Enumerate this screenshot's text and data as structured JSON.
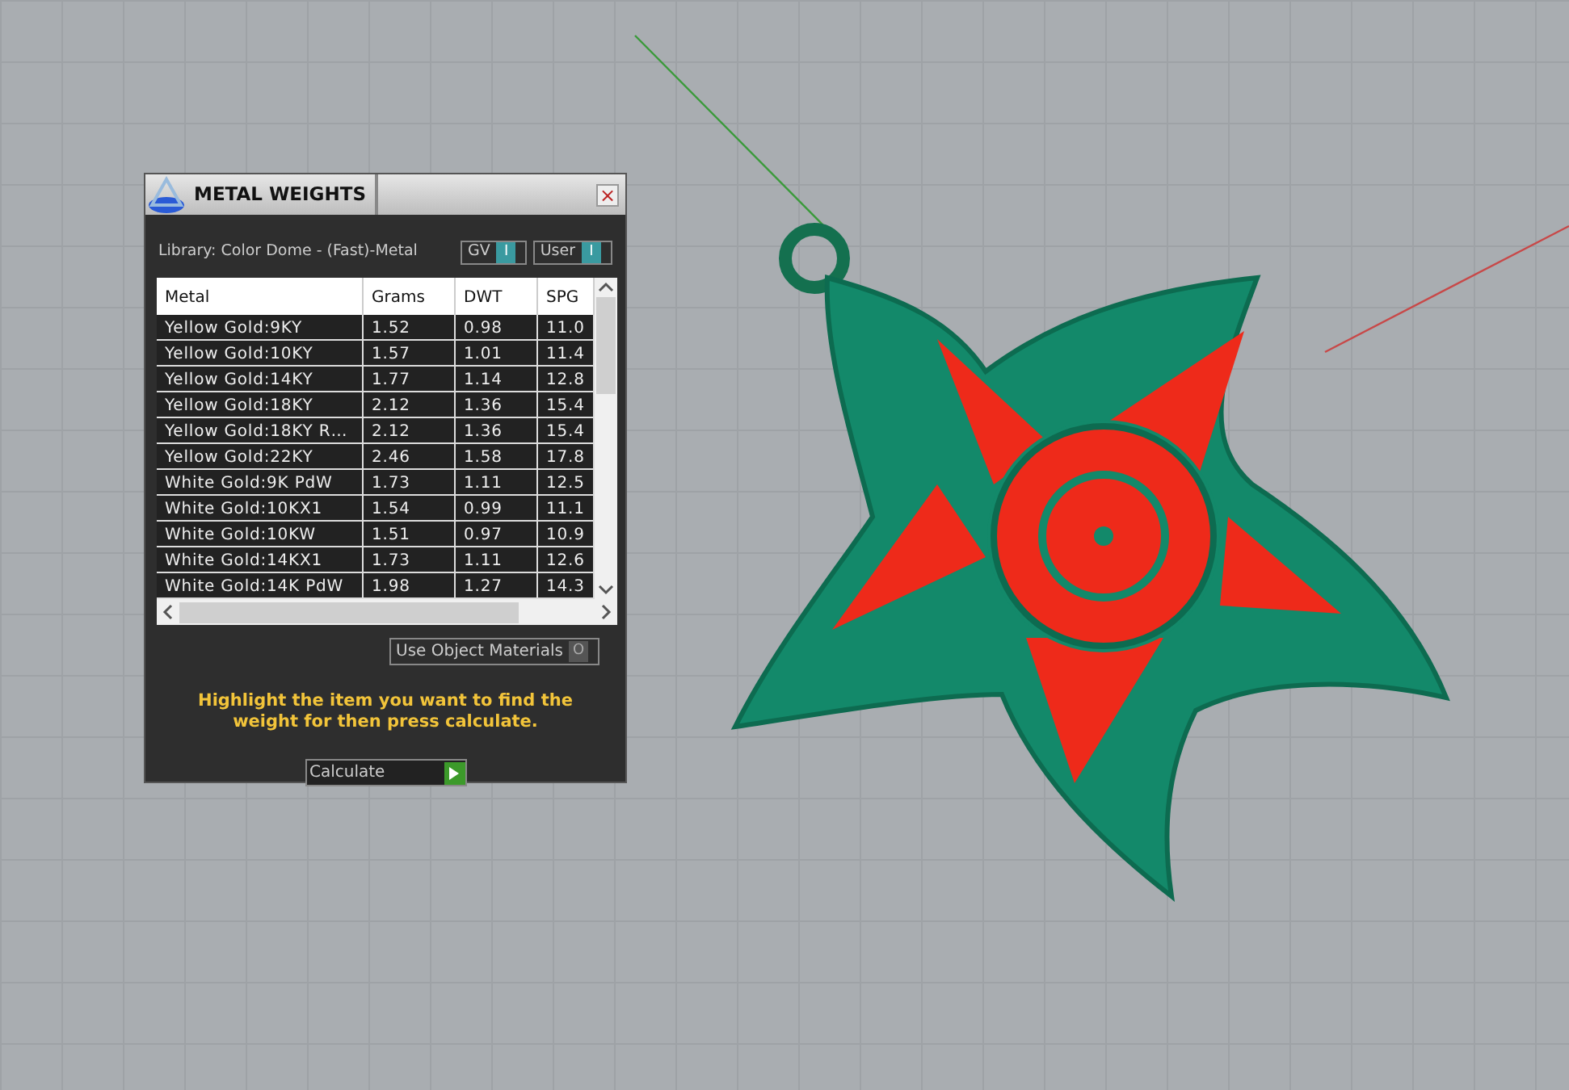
{
  "panel": {
    "title": "METAL WEIGHTS",
    "close": "×",
    "library": "Library: Color Dome - (Fast)-Metal",
    "toggles": [
      {
        "label": "GV",
        "glyph": "I",
        "on": true
      },
      {
        "label": "User",
        "glyph": "I",
        "on": true
      }
    ],
    "table": {
      "columns": [
        "Metal",
        "Grams",
        "DWT",
        "SPG"
      ],
      "rows": [
        [
          "Yellow Gold:9KY",
          "1.52",
          "0.98",
          "11.0"
        ],
        [
          "Yellow Gold:10KY",
          "1.57",
          "1.01",
          "11.4"
        ],
        [
          "Yellow Gold:14KY",
          "1.77",
          "1.14",
          "12.8"
        ],
        [
          "Yellow Gold:18KY",
          "2.12",
          "1.36",
          "15.4"
        ],
        [
          "Yellow Gold:18KY R…",
          "2.12",
          "1.36",
          "15.4"
        ],
        [
          "Yellow Gold:22KY",
          "2.46",
          "1.58",
          "17.8"
        ],
        [
          "White Gold:9K PdW",
          "1.73",
          "1.11",
          "12.5"
        ],
        [
          "White Gold:10KX1",
          "1.54",
          "0.99",
          "11.1"
        ],
        [
          "White Gold:10KW",
          "1.51",
          "0.97",
          "10.9"
        ],
        [
          "White Gold:14KX1",
          "1.73",
          "1.11",
          "12.6"
        ],
        [
          "White Gold:14K PdW",
          "1.98",
          "1.27",
          "14.3"
        ]
      ]
    },
    "object_materials": {
      "label": "Use Object Materials",
      "glyph": "O",
      "on": false
    },
    "hint": "Highlight the item you want to find the weight for then press calculate.",
    "calculate": {
      "label": "Calculate"
    }
  }
}
